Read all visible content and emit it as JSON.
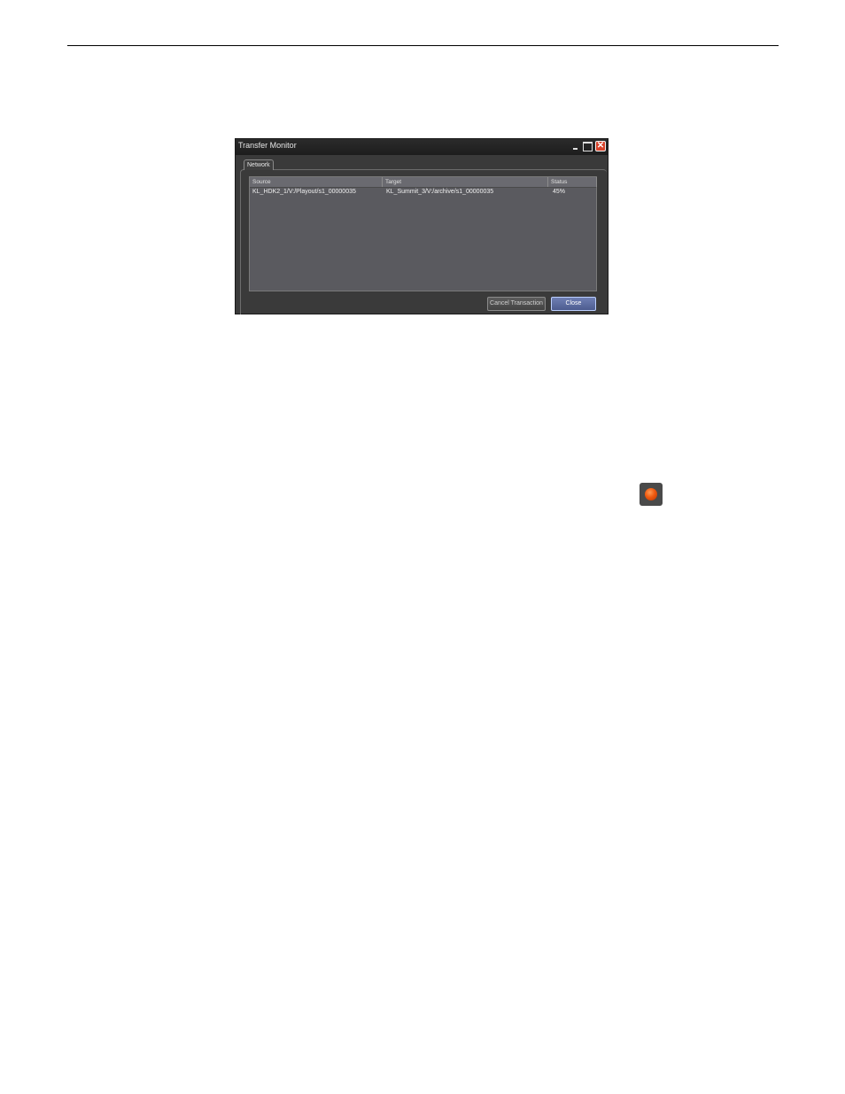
{
  "window": {
    "title": "Transfer Monitor",
    "close_glyph": "✕"
  },
  "tabs": [
    {
      "label": "Network"
    }
  ],
  "table": {
    "columns": [
      "Source",
      "Target",
      "Status"
    ],
    "rows": [
      {
        "source": "KL_HDK2_1/V:/Playout/s1_00000035",
        "target": "KL_Summit_3/V:/archive/s1_00000035",
        "status": "45%"
      }
    ]
  },
  "buttons": {
    "cancel_label": "Cancel Transaction",
    "close_label": "Close"
  },
  "icons": {
    "record": "record-icon"
  },
  "colors": {
    "window_bg": "#3a3a3a",
    "list_bg": "#5a5a5f",
    "close_button_accent": "#d8432b",
    "record_orange": "#f05a10"
  }
}
